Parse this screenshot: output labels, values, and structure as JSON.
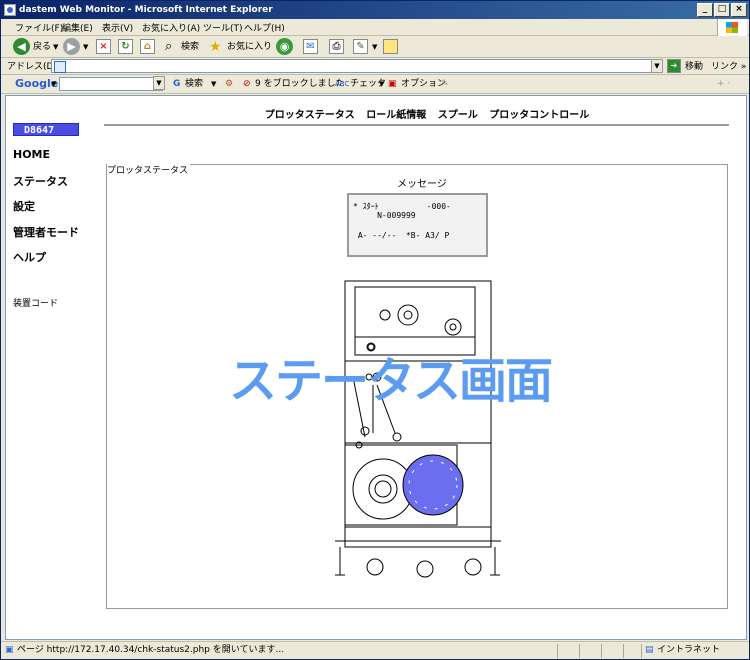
{
  "window": {
    "title": "dastem Web Monitor - Microsoft Internet Explorer"
  },
  "menu": [
    "ファイル(F)",
    "編集(E)",
    "表示(V)",
    "お気に入り(A)",
    "ツール(T)",
    "ヘルプ(H)"
  ],
  "toolbar": {
    "back": "戻る",
    "search": "検索",
    "favorites": "お気に入り"
  },
  "address": {
    "label": "アドレス(D)",
    "value": "",
    "go": "移動",
    "links": "リンク »"
  },
  "googlebar": {
    "brand": "Google",
    "search": "検索",
    "blocked": "9 をブロックしました",
    "check": "チェック",
    "options": "オプション"
  },
  "topnav": [
    "プロッタステータス",
    "ロール紙情報",
    "スプール",
    "プロッタコントロール"
  ],
  "sidebar": {
    "badge": "D8647",
    "items": [
      "HOME",
      "ステータス",
      "設定",
      "管理者モード",
      "ヘルプ"
    ],
    "device_code": "装置コード"
  },
  "panel": {
    "label": "プロッタステータス",
    "message_label": "メッセージ",
    "message_lines": [
      "* ｽﾀｰﾄ          -000-",
      "     N-009999",
      "",
      " A- --/--  *B- A3/ P"
    ]
  },
  "overlay_text": "ステータス画面",
  "status": {
    "text": "ページ http://172.17.40.34/chk-status2.php を開いています...",
    "zone": "イントラネット"
  }
}
